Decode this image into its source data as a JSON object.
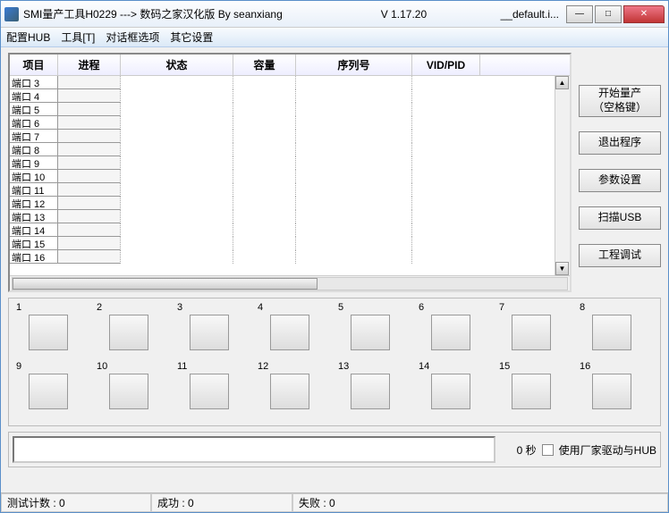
{
  "titlebar": {
    "text": "SMI量产工具H0229 ---> 数码之家汉化版 By seanxiang",
    "version": "V 1.17.20",
    "file": "__default.i..."
  },
  "menu": {
    "items": [
      "配置HUB",
      "工具[T]",
      "对话框选项",
      "其它设置"
    ]
  },
  "table": {
    "headers": [
      "项目",
      "进程",
      "状态",
      "容量",
      "序列号",
      "VID/PID"
    ],
    "rows": [
      {
        "label": "端口 3"
      },
      {
        "label": "端口 4"
      },
      {
        "label": "端口 5"
      },
      {
        "label": "端口 6"
      },
      {
        "label": "端口 7"
      },
      {
        "label": "端口 8"
      },
      {
        "label": "端口 9"
      },
      {
        "label": "端口 10"
      },
      {
        "label": "端口 11"
      },
      {
        "label": "端口 12"
      },
      {
        "label": "端口 13"
      },
      {
        "label": "端口 14"
      },
      {
        "label": "端口 15"
      },
      {
        "label": "端口 16"
      }
    ]
  },
  "sideButtons": {
    "start": "开始量产\n（空格键）",
    "exit": "退出程序",
    "settings": "参数设置",
    "scan": "扫描USB",
    "debug": "工程调试"
  },
  "ports": [
    "1",
    "2",
    "3",
    "4",
    "5",
    "6",
    "7",
    "8",
    "9",
    "10",
    "11",
    "12",
    "13",
    "14",
    "15",
    "16"
  ],
  "bottom": {
    "seconds": "0 秒",
    "checkbox": "使用厂家驱动与HUB"
  },
  "status": {
    "tests": "测试计数 : 0",
    "success": "成功 : 0",
    "fail": "失败 : 0"
  },
  "winbtns": {
    "min": "—",
    "max": "□",
    "close": "✕"
  }
}
